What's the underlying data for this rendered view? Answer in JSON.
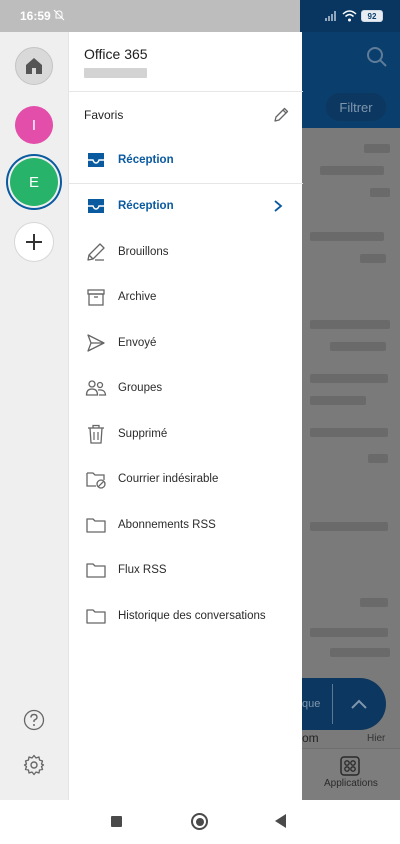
{
  "status_bar": {
    "time": "16:59",
    "battery": "92"
  },
  "background": {
    "filter_label": "Filtrer",
    "fab_label": "que",
    "bottom_text": "om",
    "hier": "Hier",
    "apps_label": "Applications"
  },
  "rail": {
    "avatars": [
      {
        "initial": "I",
        "color": "#e24eaa"
      },
      {
        "initial": "E",
        "color": "#27b36a"
      }
    ]
  },
  "drawer": {
    "account_title": "Office 365",
    "favorites_label": "Favoris",
    "favorite_folder": "Réception",
    "folders": [
      {
        "label": "Réception",
        "icon": "inbox-icon",
        "active": true
      },
      {
        "label": "Brouillons",
        "icon": "pencil-draft-icon",
        "active": false
      },
      {
        "label": "Archive",
        "icon": "archive-box-icon",
        "active": false
      },
      {
        "label": "Envoyé",
        "icon": "send-icon",
        "active": false
      },
      {
        "label": "Groupes",
        "icon": "groups-icon",
        "active": false
      },
      {
        "label": "Supprimé",
        "icon": "trash-icon",
        "active": false
      },
      {
        "label": "Courrier indésirable",
        "icon": "junk-folder-icon",
        "active": false
      },
      {
        "label": "Abonnements RSS",
        "icon": "folder-icon",
        "active": false
      },
      {
        "label": "Flux RSS",
        "icon": "folder-icon",
        "active": false
      },
      {
        "label": "Historique des conversations",
        "icon": "folder-icon",
        "active": false
      }
    ]
  },
  "colors": {
    "accent": "#0a5aa0",
    "header_bg": "#0a3e6c",
    "rail_bg": "#efefef"
  }
}
